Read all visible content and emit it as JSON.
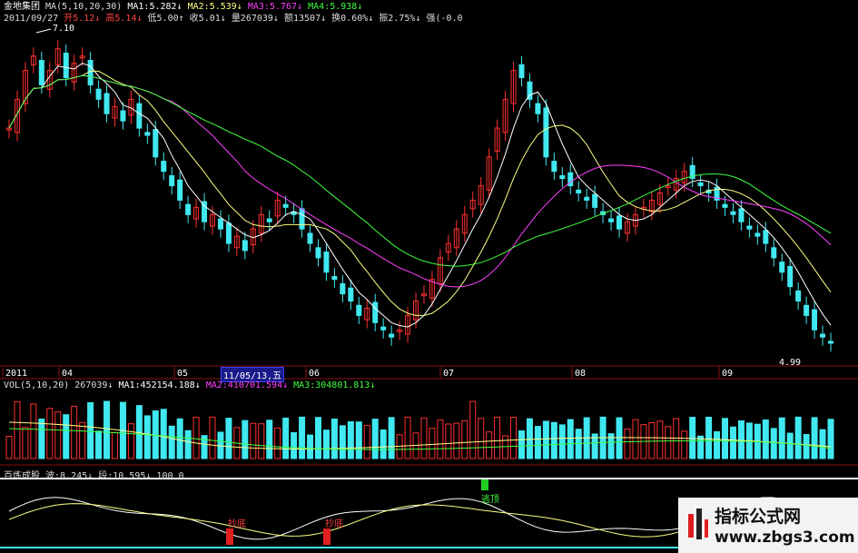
{
  "header": {
    "stock_name": "金地集团",
    "ma_label": "MA(5,10,20,30)",
    "ma1": "MA1:5.282↓",
    "ma2": "MA2:5.539↓",
    "ma3": "MA3:5.767↓",
    "ma4": "MA4:5.938↓",
    "date": "2011/09/27",
    "open": "开5.12↓",
    "high": "高5.14↓",
    "low": "低5.00↑",
    "close": "收5.01↓",
    "volume": "量267039↓",
    "amount": "额13507↓",
    "turnover": "换0.60%↓",
    "amplitude": "振2.75%↓",
    "strength": "强(-0.0"
  },
  "price_labels": {
    "high_marker": "7.10",
    "low_marker": "4.99"
  },
  "x_axis": {
    "labels": [
      "2011",
      "04",
      "05",
      "06",
      "07",
      "08",
      "09"
    ],
    "highlight_date": "11/05/13,五"
  },
  "volume_panel": {
    "title": "VOL(5,10,20)",
    "vol": "267039↓",
    "ma1": "MA1:452154.188↓",
    "ma2": "MA2:410701.594↓",
    "ma3": "MA3:304801.813↓"
  },
  "indicator_panel": {
    "title": "百炼成股",
    "line1": "波:8.245↓",
    "line2": "段:10.595↓",
    "value": "100 0",
    "signals": [
      "抄底",
      "抄底",
      "逃顶"
    ]
  },
  "watermark": {
    "line1": "指标公式网",
    "line2": "www.zbgs3.com"
  },
  "colors": {
    "up": "#ff3030",
    "down": "#40e8f0",
    "ma1": "#ffffff",
    "ma2": "#ffff80",
    "ma3": "#ff40ff",
    "ma4": "#40ff40"
  },
  "chart_data": {
    "type": "candlestick",
    "closes": [
      6.5,
      6.7,
      6.9,
      7.0,
      6.8,
      6.9,
      7.05,
      6.85,
      6.95,
      7.0,
      6.8,
      6.7,
      6.6,
      6.65,
      6.55,
      6.7,
      6.5,
      6.45,
      6.3,
      6.2,
      6.1,
      6.0,
      5.9,
      5.95,
      5.85,
      5.9,
      5.8,
      5.7,
      5.75,
      5.65,
      5.8,
      5.9,
      5.85,
      6.0,
      5.95,
      5.9,
      5.8,
      5.7,
      5.6,
      5.5,
      5.45,
      5.35,
      5.3,
      5.2,
      5.25,
      5.15,
      5.1,
      5.05,
      5.1,
      5.2,
      5.3,
      5.35,
      5.45,
      5.6,
      5.7,
      5.8,
      5.9,
      6.0,
      6.1,
      6.3,
      6.5,
      6.7,
      6.9,
      6.85,
      6.7,
      6.6,
      6.3,
      6.2,
      6.15,
      6.1,
      6.05,
      6.0,
      5.95,
      5.9,
      5.85,
      5.8,
      5.85,
      5.9,
      5.95,
      6.0,
      6.05,
      6.1,
      6.15,
      6.2,
      6.15,
      6.1,
      6.05,
      6.0,
      5.95,
      5.9,
      5.85,
      5.8,
      5.75,
      5.7,
      5.6,
      5.5,
      5.4,
      5.3,
      5.2,
      5.1,
      5.05,
      5.01
    ]
  }
}
